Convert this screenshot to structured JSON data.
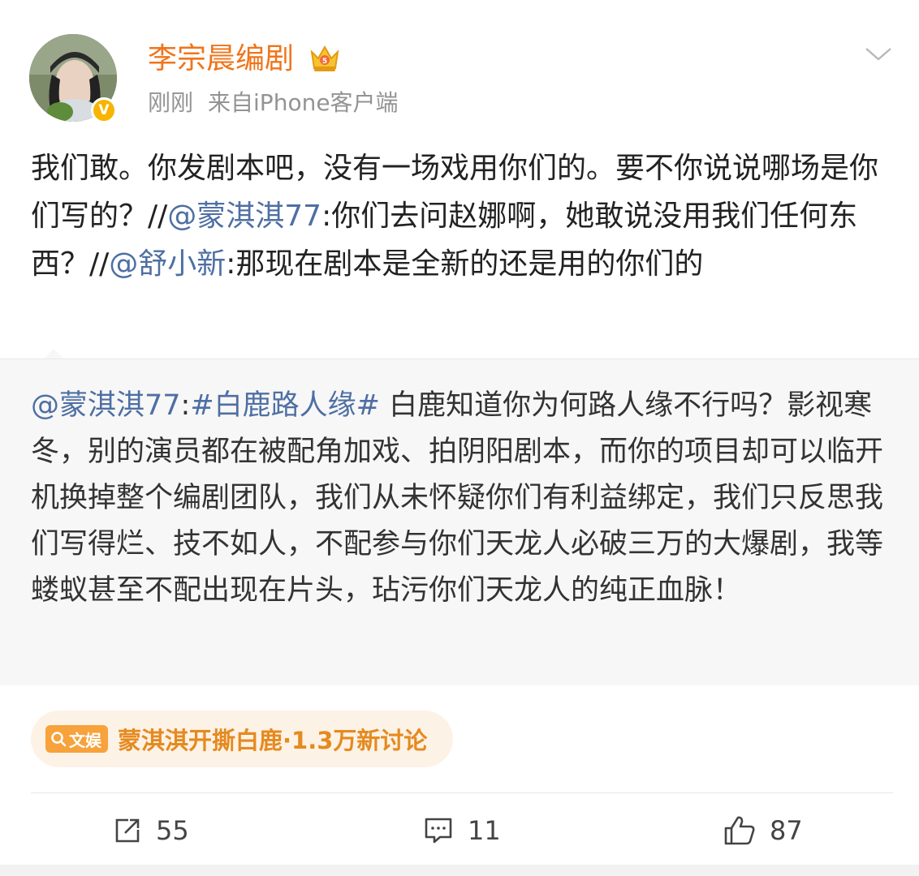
{
  "user": {
    "name": "李宗晨编剧",
    "verified_badge": "V",
    "meta_time": "刚刚",
    "meta_source": "来自",
    "meta_client": "iPhone客户端"
  },
  "post": {
    "segments": [
      {
        "text": "我们敢。你发剧本吧，没有一场戏用你们的。要不你说说哪场是你们写的？//",
        "type": "text"
      },
      {
        "text": "@蒙淇淇77",
        "type": "mention"
      },
      {
        "text": ":你们去问赵娜啊，她敢说没用我们任何东西？//",
        "type": "text"
      },
      {
        "text": "@舒小新",
        "type": "mention"
      },
      {
        "text": ":那现在剧本是全新的还是用的你们的",
        "type": "text"
      }
    ]
  },
  "repost": {
    "segments": [
      {
        "text": "@蒙淇淇77",
        "type": "mention"
      },
      {
        "text": ":",
        "type": "text"
      },
      {
        "text": "#白鹿路人缘#",
        "type": "mention"
      },
      {
        "text": " 白鹿知道你为何路人缘不行吗？影视寒冬，别的演员都在被配角加戏、拍阴阳剧本，而你的项目却可以临开机换掉整个编剧团队，我们从未怀疑你们有利益绑定，我们只反思我们写得烂、技不如人，不配参与你们天龙人必破三万的大爆剧，我等蝼蚁甚至不配出现在片头，玷污你们天龙人的纯正血脉！",
        "type": "text"
      }
    ]
  },
  "topic": {
    "badge_label": "文娱",
    "text": "蒙淇淇开撕白鹿·1.3万新讨论"
  },
  "actions": {
    "share_count": "55",
    "comment_count": "11",
    "like_count": "87"
  },
  "colors": {
    "username": "#f0741a",
    "mention": "#4e6fa3",
    "verified": "#f7b500",
    "topic_text": "#e58a1f",
    "topic_bg": "#fdf2e6"
  },
  "icons": {
    "crown": "crown-icon",
    "chevron": "chevron-down-icon",
    "share": "share-icon",
    "comment": "comment-icon",
    "like": "like-icon",
    "search": "search-icon"
  }
}
